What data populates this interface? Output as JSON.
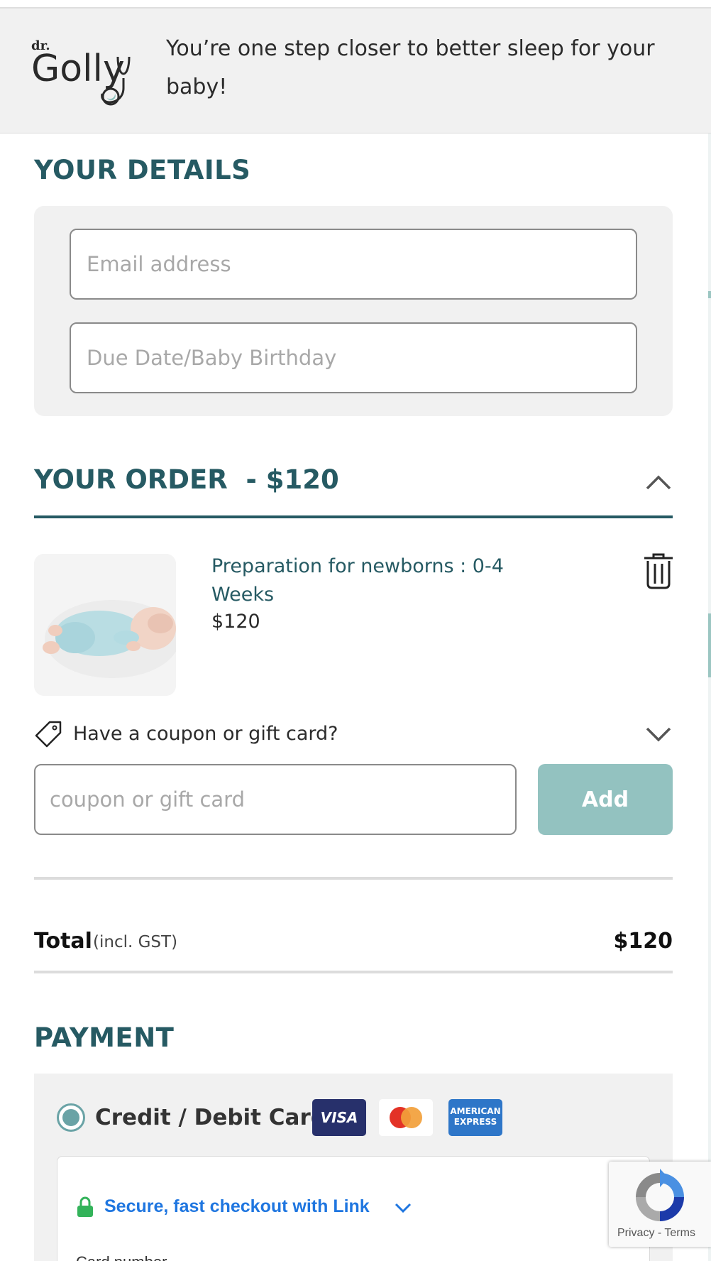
{
  "header": {
    "logo_text": "dr. Golly",
    "message": "You’re one step closer to better sleep for your baby!"
  },
  "details": {
    "title": "YOUR DETAILS",
    "email_placeholder": "Email address",
    "due_date_placeholder": "Due Date/Baby Birthday"
  },
  "order": {
    "title": "YOUR ORDER  - $120",
    "item": {
      "name": "Preparation for newborns : 0-4 Weeks",
      "price": "$120",
      "image_alt": "sleeping newborn baby"
    },
    "coupon": {
      "label": "Have a coupon or gift card?",
      "placeholder": "coupon or gift card",
      "add_label": "Add"
    },
    "total": {
      "label": "Total",
      "note": "(incl. GST)",
      "value": "$120"
    }
  },
  "payment": {
    "title": "PAYMENT",
    "method_label": "Credit / Debit Card",
    "card_logos": [
      "VISA",
      "Mastercard",
      "AMERICAN EXPRESS"
    ],
    "link_text": "Secure, fast checkout with Link",
    "card_number_label": "Card number"
  },
  "recaptcha": {
    "privacy": "Privacy",
    "separator": " - ",
    "terms": "Terms"
  },
  "colors": {
    "brand_teal": "#265a63",
    "button_teal": "#93c2c0",
    "link_blue": "#1f76e0",
    "panel_gray": "#f1f1f1"
  },
  "icons": [
    "logo-stethoscope",
    "chevron-up-icon",
    "trash-icon",
    "tag-icon",
    "chevron-down-icon",
    "lock-icon",
    "recaptcha-icon"
  ]
}
